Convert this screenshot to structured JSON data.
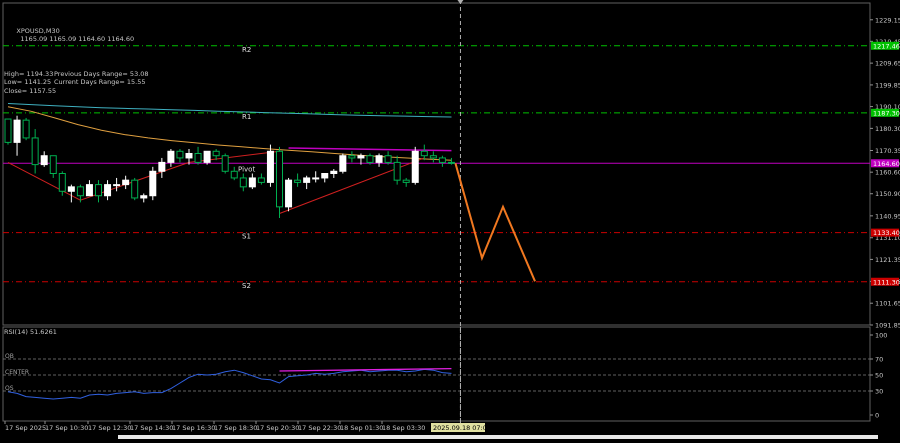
{
  "window": {
    "symbol_line": "XPOUSD,M30",
    "ohlc_line": "1165.09 1165.09 1164.60 1164.60",
    "info_rows": [
      {
        "k1": "High= 1194.33",
        "k2": "Previous Days Range= 53.08"
      },
      {
        "k1": "Low= 1141.25",
        "k2": "Current Days Range= 15.55"
      },
      {
        "k1": "Close= 1157.55",
        "k2": ""
      }
    ]
  },
  "colors": {
    "background": "#000000",
    "bull_candle": "#ffffff",
    "bear_candle": "#00b050",
    "level_line_green": "#00c000",
    "support_red": "#cc0000",
    "current_price": "#c000c0",
    "teal_ma": "#3fb0c0",
    "orange_ma": "#e0a040",
    "forecast": "#f07820",
    "rsi_line": "#3060e0",
    "rsi_magenta": "#e020e0",
    "trend_red": "#d02020"
  },
  "chart_data": {
    "type": "candlestick",
    "symbol": "XPOUSD",
    "timeframe": "M30",
    "ylim": [
      1091.85,
      1234.0
    ],
    "y_ticks": [
      1229.15,
      1219.45,
      1209.65,
      1199.85,
      1190.1,
      1180.3,
      1170.35,
      1160.6,
      1150.9,
      1140.95,
      1131.1,
      1121.35,
      1111.45,
      1101.65,
      1091.85
    ],
    "levels": [
      {
        "name": "R2",
        "price": 1217.46,
        "label": "1217.46",
        "color": "#00c000"
      },
      {
        "name": "R1",
        "price": 1187.3,
        "label": "1187.30",
        "color": "#00c000"
      },
      {
        "name": "Pivot",
        "price": 1164.6,
        "label": "1164.60",
        "color": "#c000c0"
      },
      {
        "name": "S1",
        "price": 1133.4,
        "label": "1133.40",
        "color": "#cc0000"
      },
      {
        "name": "S2",
        "price": 1111.3,
        "label": "1111.30",
        "color": "#cc0000"
      }
    ],
    "candles": [
      [
        1184.5,
        1184.0,
        1173.0,
        1174.0
      ],
      [
        1174.0,
        1186.0,
        1168.0,
        1184.0
      ],
      [
        1184.0,
        1185.0,
        1175.0,
        1176.0
      ],
      [
        1176.0,
        1180.0,
        1160.0,
        1164.0
      ],
      [
        1164.0,
        1170.0,
        1163.0,
        1168.0
      ],
      [
        1168.0,
        1168.0,
        1158.0,
        1160.0
      ],
      [
        1160.0,
        1161.0,
        1150.0,
        1152.0
      ],
      [
        1152.0,
        1155.0,
        1147.0,
        1154.0
      ],
      [
        1154.0,
        1155.0,
        1147.0,
        1150.0
      ],
      [
        1150.0,
        1157.0,
        1150.0,
        1155.0
      ],
      [
        1155.0,
        1157.0,
        1147.0,
        1150.0
      ],
      [
        1150.0,
        1157.0,
        1148.0,
        1155.0
      ],
      [
        1155.0,
        1158.0,
        1152.0,
        1155.0
      ],
      [
        1155.0,
        1159.0,
        1153.0,
        1157.0
      ],
      [
        1157.0,
        1158.0,
        1148.0,
        1149.0
      ],
      [
        1149.0,
        1151.0,
        1147.0,
        1150.0
      ],
      [
        1150.0,
        1163.0,
        1148.0,
        1161.0
      ],
      [
        1161.0,
        1167.0,
        1158.0,
        1165.0
      ],
      [
        1165.0,
        1171.0,
        1163.0,
        1170.0
      ],
      [
        1170.0,
        1171.0,
        1165.0,
        1167.0
      ],
      [
        1167.0,
        1171.0,
        1164.0,
        1169.0
      ],
      [
        1169.0,
        1172.0,
        1164.0,
        1165.0
      ],
      [
        1165.0,
        1170.0,
        1164.0,
        1170.0
      ],
      [
        1170.0,
        1171.0,
        1166.0,
        1168.0
      ],
      [
        1168.0,
        1169.0,
        1160.0,
        1161.0
      ],
      [
        1161.0,
        1163.0,
        1157.0,
        1158.0
      ],
      [
        1158.0,
        1160.0,
        1152.0,
        1154.0
      ],
      [
        1154.0,
        1160.0,
        1153.0,
        1158.0
      ],
      [
        1158.0,
        1160.0,
        1155.0,
        1156.0
      ],
      [
        1156.0,
        1173.0,
        1154.0,
        1170.0
      ],
      [
        1170.0,
        1172.0,
        1140.0,
        1145.0
      ],
      [
        1145.0,
        1158.0,
        1143.0,
        1157.0
      ],
      [
        1157.0,
        1160.0,
        1154.0,
        1156.0
      ],
      [
        1156.0,
        1159.0,
        1153.0,
        1158.0
      ],
      [
        1158.0,
        1161.0,
        1156.0,
        1158.0
      ],
      [
        1158.0,
        1160.0,
        1156.0,
        1160.0
      ],
      [
        1160.0,
        1162.0,
        1158.0,
        1161.0
      ],
      [
        1161.0,
        1169.0,
        1160.0,
        1168.0
      ],
      [
        1168.0,
        1170.0,
        1165.0,
        1167.0
      ],
      [
        1167.0,
        1169.0,
        1164.0,
        1168.0
      ],
      [
        1168.0,
        1169.0,
        1164.0,
        1165.0
      ],
      [
        1165.0,
        1169.0,
        1163.0,
        1168.0
      ],
      [
        1168.0,
        1170.0,
        1164.0,
        1165.0
      ],
      [
        1165.0,
        1168.0,
        1155.0,
        1157.0
      ],
      [
        1157.0,
        1158.0,
        1154.0,
        1156.0
      ],
      [
        1156.0,
        1172.0,
        1155.0,
        1170.0
      ],
      [
        1170.0,
        1173.0,
        1166.0,
        1168.0
      ],
      [
        1168.0,
        1170.0,
        1165.0,
        1167.0
      ],
      [
        1167.0,
        1168.0,
        1163.0,
        1165.0
      ],
      [
        1165.0,
        1167.0,
        1164.0,
        1164.6
      ]
    ],
    "teal_ma": [
      1191.5,
      1191.0,
      1190.5,
      1190.0,
      1189.6,
      1189.3,
      1189.0,
      1188.7,
      1188.4,
      1188.0,
      1187.7,
      1187.4,
      1187.1,
      1186.8,
      1186.5,
      1186.2,
      1186.0,
      1185.8,
      1185.6,
      1185.4
    ],
    "orange_ma": [
      1190.0,
      1188.0,
      1185.0,
      1182.0,
      1179.5,
      1177.5,
      1176.0,
      1174.8,
      1173.8,
      1172.8,
      1172.0,
      1171.2,
      1170.5,
      1169.8,
      1169.0,
      1168.3,
      1167.6,
      1167.0,
      1166.5,
      1166.0
    ],
    "trend_lines": [
      {
        "from": [
          0,
          1165.0
        ],
        "to": [
          8,
          1148.0
        ]
      },
      {
        "from": [
          8,
          1148.0
        ],
        "to": [
          20,
          1165.0
        ]
      },
      {
        "from": [
          20,
          1165.0
        ],
        "to": [
          30,
          1170.0
        ]
      },
      {
        "from": [
          30,
          1142.0
        ],
        "to": [
          46,
          1167.0
        ]
      }
    ],
    "resistance_line": {
      "from": [
        31,
        1171.5
      ],
      "to": [
        49,
        1170.3
      ]
    },
    "forecast_path": [
      1164.6,
      1122.0,
      1145.0,
      1111.5
    ],
    "rsi": {
      "label": "RSI(14) 51.6261",
      "period": 14,
      "value": 51.6261,
      "levels": [
        {
          "label": "OB",
          "value": 70
        },
        {
          "label": "CENTER",
          "value": 50
        },
        {
          "label": "OS",
          "value": 30
        }
      ],
      "y_ticks": [
        100,
        70,
        50,
        30,
        0
      ],
      "values": [
        29,
        27,
        23,
        22,
        21,
        20,
        21,
        22,
        21,
        25,
        26,
        25,
        27,
        28,
        29,
        27,
        28,
        28,
        33,
        40,
        47,
        51,
        50,
        51,
        54,
        56,
        53,
        49,
        45,
        44,
        40,
        48,
        49,
        50,
        52,
        51,
        52,
        54,
        55,
        56,
        54,
        55,
        56,
        56,
        54,
        55,
        57,
        56,
        53,
        52
      ],
      "magenta_segment": {
        "from": [
          30,
          55
        ],
        "to": [
          49,
          58
        ]
      }
    },
    "x_ticks": [
      "17 Sep 2025",
      "17 Sep 10:30",
      "17 Sep 12:30",
      "17 Sep 14:30",
      "17 Sep 16:30",
      "17 Sep 18:30",
      "17 Sep 20:30",
      "17 Sep 22:30",
      "18 Sep 01:30",
      "18 Sep 03:30"
    ],
    "crosshair_time_label": "2025.09.18 07:00"
  }
}
